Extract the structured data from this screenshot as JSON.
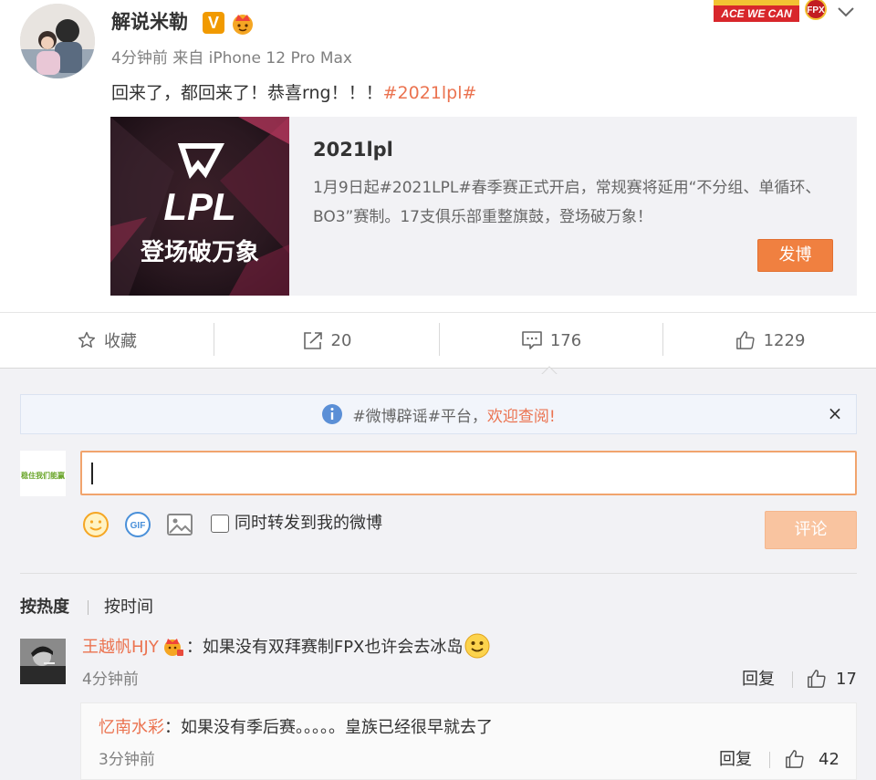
{
  "post": {
    "username": "解说米勒",
    "verified_badge": "V",
    "meta": "4分钟前 来自 iPhone 12 Pro Max",
    "text_main": "回来了，都回来了！恭喜rng！！！",
    "text_tag": "#2021lpl#",
    "banner_text": "ACE WE CAN",
    "banner_team": "FPX"
  },
  "card": {
    "title": "2021lpl",
    "description": "1月9日起#2021LPL#春季赛正式开启，常规赛将延用“不分组、单循环、BO3”赛制。17支俱乐部重整旗鼓，登场破万象！",
    "button_label": "发博",
    "image_logo_text": "LPL",
    "image_slogan": "登场破万象"
  },
  "actions": {
    "favorite_label": "收藏",
    "repost_count": "20",
    "comment_count": "176",
    "like_count": "1229"
  },
  "notice": {
    "text": "#微博辟谣#平台，",
    "highlight": "欢迎查阅!",
    "close": "×"
  },
  "composer": {
    "avatar_text": "稳住我们能赢",
    "input_value": "",
    "repost_checkbox_label": "同时转发到我的微博",
    "submit_label": "评论"
  },
  "sort": {
    "hot": "按热度",
    "time": "按时间"
  },
  "comments": [
    {
      "user": "王越帆HJY",
      "text": "：如果没有双拜赛制FPX也许会去冰岛",
      "time": "4分钟前",
      "reply_label": "回复",
      "likes": "17",
      "replies": [
        {
          "user": "忆南水彩",
          "text": "：如果没有季后赛。。。。。皇族已经很早就去了",
          "time": "3分钟前",
          "reply_label": "回复",
          "likes": "42"
        }
      ]
    }
  ],
  "colors": {
    "accent": "#eb7350",
    "button_orange": "#f08040",
    "submit_disabled": "#f9c4a0",
    "comment_bg": "#f2f2f5"
  }
}
